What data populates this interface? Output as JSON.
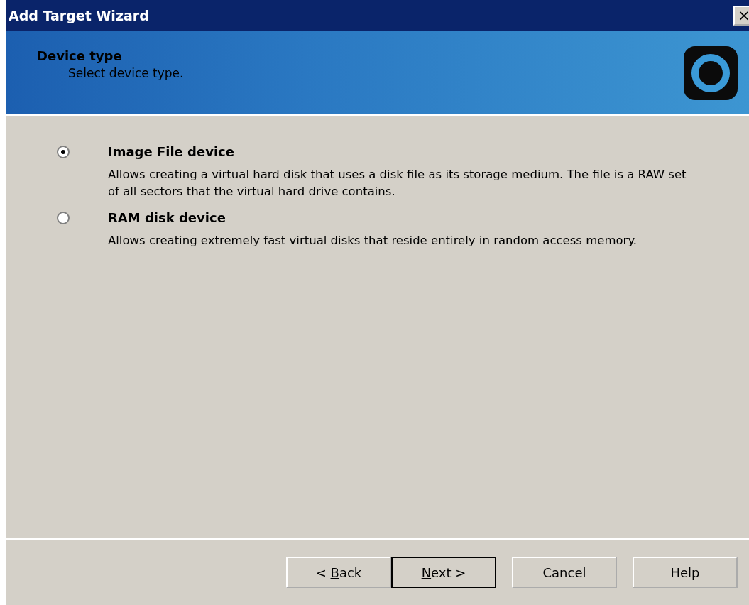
{
  "window": {
    "title": "Add Target Wizard",
    "close": "×"
  },
  "header": {
    "title": "Device type",
    "subtitle": "Select device type."
  },
  "options": [
    {
      "label": "Image File device",
      "description": "Allows creating a virtual hard disk that uses a disk file as its storage medium. The file is a RAW set of all sectors that the virtual hard drive contains.",
      "selected": true
    },
    {
      "label": "RAM disk device",
      "description": "Allows creating extremely fast virtual disks that reside entirely in random access memory.",
      "selected": false
    }
  ],
  "buttons": [
    {
      "before": "< ",
      "mnemonic": "B",
      "after": "ack",
      "default": false
    },
    {
      "mnemonic": "N",
      "after": "ext >",
      "default": true
    },
    {
      "before": "Cancel",
      "default": false
    },
    {
      "before": "Help",
      "default": false
    }
  ]
}
